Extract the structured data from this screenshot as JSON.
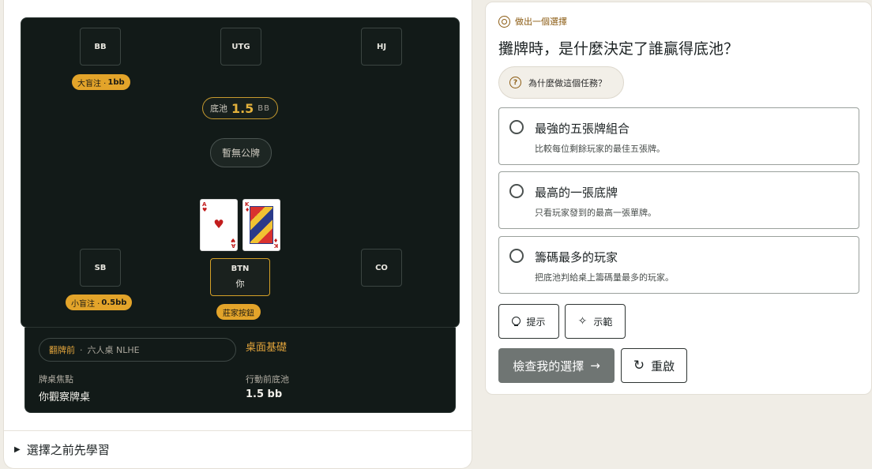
{
  "table": {
    "seats": [
      {
        "id": "bb",
        "label": "BB"
      },
      {
        "id": "utg",
        "label": "UTG"
      },
      {
        "id": "hj",
        "label": "HJ"
      },
      {
        "id": "sb",
        "label": "SB"
      },
      {
        "id": "btn",
        "label": "BTN",
        "sub": "你"
      },
      {
        "id": "co",
        "label": "CO"
      }
    ],
    "bb_badge": {
      "prefix": "大盲注 ·",
      "amount": "1bb"
    },
    "sb_badge": {
      "prefix": "小盲注 ·",
      "amount": "0.5bb"
    },
    "dealer_badge": "莊家按鈕",
    "pot": {
      "label": "底池",
      "value": "1.5",
      "unit": "BB"
    },
    "board": "暫無公牌",
    "hero_cards": [
      {
        "rank": "A",
        "suit": "♥",
        "color": "#c21d1d"
      },
      {
        "rank": "K",
        "suit": "♦",
        "color": "#c21d1d"
      }
    ]
  },
  "info": {
    "street": "翻牌前",
    "separator": "·",
    "game": "六人桌 NLHE",
    "section_title": "桌面基礎",
    "focus_label": "牌桌焦點",
    "focus_value": "你觀察牌桌",
    "pot_label": "行動前底池",
    "pot_value": "1.5 bb"
  },
  "learn_first": "選擇之前先學習",
  "quiz": {
    "header": "做出一個選擇",
    "question": "攤牌時，是什麼決定了誰贏得底池？",
    "why": "為什麼做這個任務？",
    "options": [
      {
        "title": "最強的五張牌組合",
        "desc": "比較每位剩餘玩家的最佳五張牌。"
      },
      {
        "title": "最高的一張底牌",
        "desc": "只看玩家發到的最高一張單牌。"
      },
      {
        "title": "籌碼最多的玩家",
        "desc": "把底池判給桌上籌碼量最多的玩家。"
      }
    ],
    "hint": "提示",
    "example": "示範",
    "check": "檢查我的選擇",
    "reset": "重啟"
  },
  "colors": {
    "accent": "#e3a42a",
    "felt": "#121a18",
    "check_button": "#6f7573"
  }
}
